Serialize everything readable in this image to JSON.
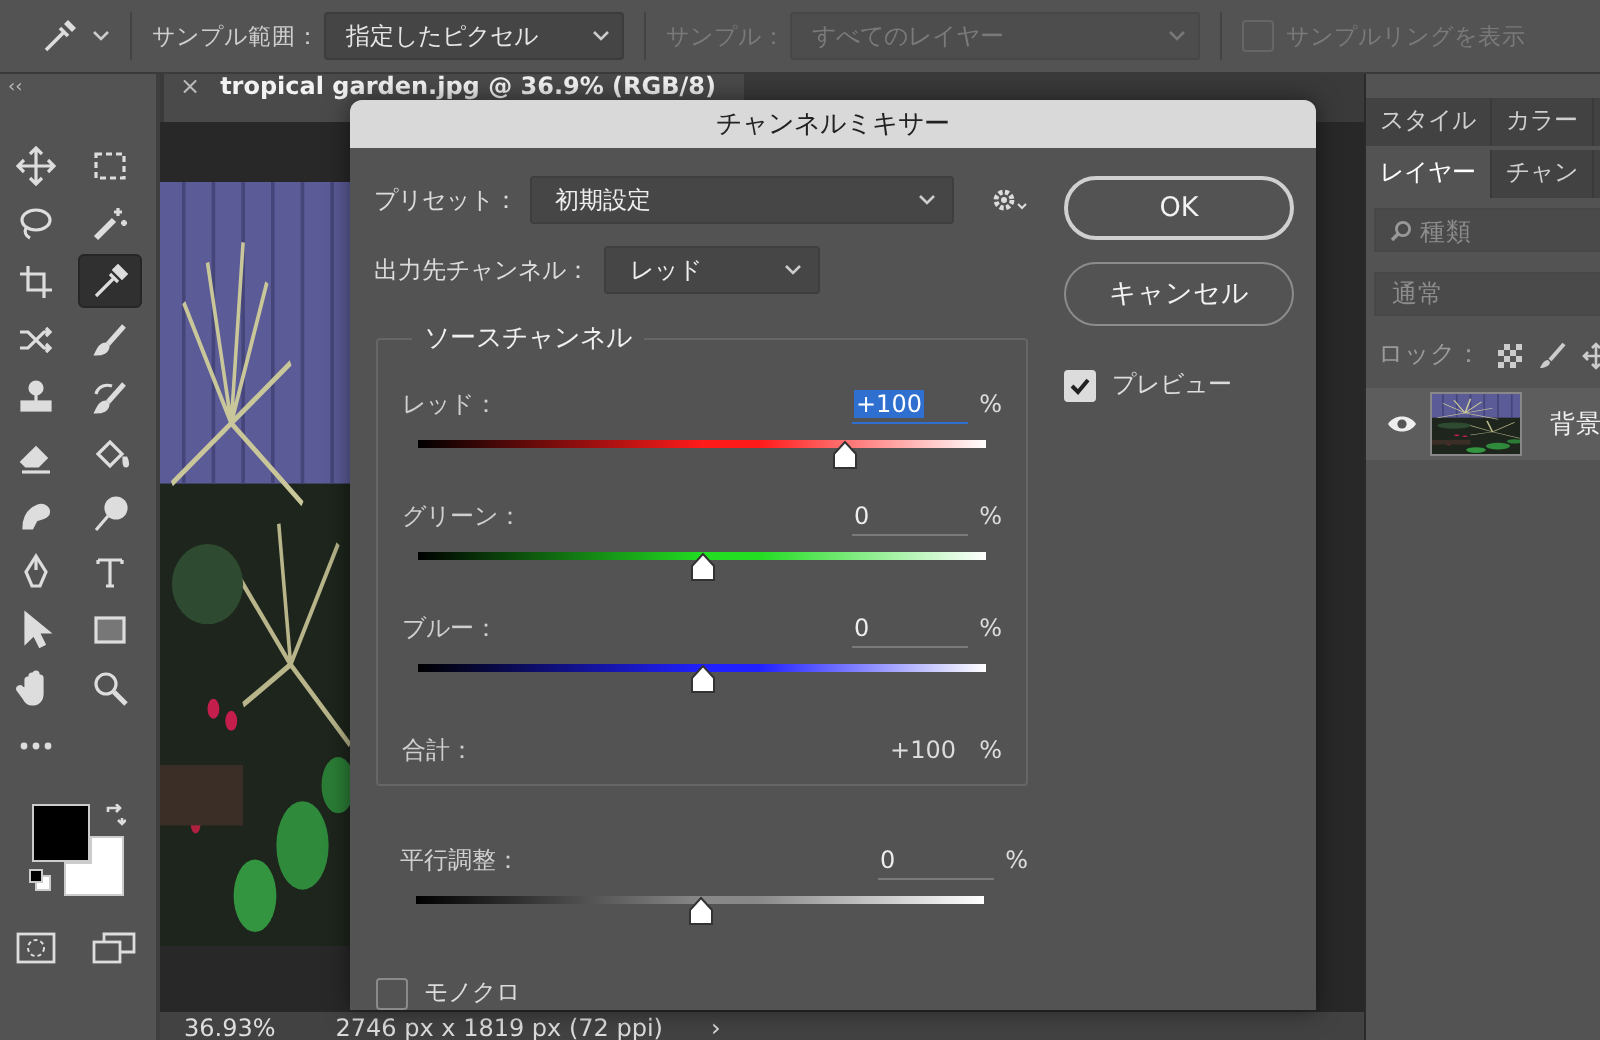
{
  "options_bar": {
    "sample_size_label": "サンプル範囲：",
    "sample_size": "指定したピクセル",
    "sample_label": "サンプル：",
    "sample": "すべてのレイヤー",
    "sample_disabled": true,
    "show_ring": {
      "label": "サンプルリングを表示",
      "checked": false,
      "disabled": true
    }
  },
  "toolbar": {
    "collapse": "‹‹",
    "tools": [
      {
        "selected": false
      },
      {
        "selected": false
      },
      {
        "selected": false
      },
      {
        "selected": false
      },
      {
        "selected": false
      },
      {
        "selected": true
      },
      {
        "selected": false
      },
      {
        "selected": false
      },
      {
        "selected": false
      },
      {
        "selected": false
      },
      {
        "selected": false
      },
      {
        "selected": false
      },
      {
        "selected": false
      },
      {
        "selected": false
      },
      {
        "selected": false
      },
      {
        "selected": false
      },
      {
        "selected": false
      },
      {
        "selected": false
      },
      {
        "selected": false
      },
      {
        "selected": false
      },
      {
        "selected": false
      }
    ],
    "swatches": [
      {
        "color": "#000000"
      },
      {
        "color": "#ffffff"
      }
    ]
  },
  "document": {
    "close": "×",
    "tab_title": "tropical garden.jpg @ 36.9% (RGB/8)",
    "zoom": "36.93%",
    "dimensions": "2746 px x 1819 px (72 ppi)",
    "status_arrow": "›"
  },
  "dialog": {
    "title": "チャンネルミキサー",
    "preset_label": "プリセット：",
    "preset": "初期設定",
    "output_label": "出力先チャンネル：",
    "output": "レッド",
    "source_legend": "ソースチャンネル",
    "channels": [
      {
        "label": "レッド：",
        "value": "+100",
        "unit": "%",
        "level": 0.75,
        "color": "#ff1a1a",
        "focused": true
      },
      {
        "label": "グリーン：",
        "value": "0",
        "unit": "%",
        "level": 0.5,
        "color": "#22dd22",
        "focused": false
      },
      {
        "label": "ブルー：",
        "value": "0",
        "unit": "%",
        "level": 0.5,
        "color": "#2020ff",
        "focused": false
      }
    ],
    "total_label": "合計：",
    "total": "+100",
    "total_unit": "%",
    "constant": {
      "label": "平行調整：",
      "value": "0",
      "unit": "%",
      "level": 0.5,
      "color": "#888888",
      "focused": false
    },
    "monochrome": {
      "label": "モノクロ",
      "checked": false
    },
    "buttons": [
      {
        "label": "OK",
        "default": true
      },
      {
        "label": "キャンセル",
        "default": false
      }
    ],
    "preview": {
      "label": "プレビュー",
      "checked": true
    }
  },
  "panels": {
    "top_tabs": [
      {
        "label": "スタイル",
        "selected": false
      },
      {
        "label": "カラー",
        "selected": false
      }
    ],
    "layer_tabs": [
      {
        "label": "レイヤー",
        "selected": true
      },
      {
        "label": "チャン",
        "selected": false
      }
    ],
    "filter_placeholder": "種類",
    "blend_mode": "通常",
    "lock_label": "ロック：",
    "layers": [
      {
        "name": "背景",
        "visible": true
      }
    ]
  }
}
